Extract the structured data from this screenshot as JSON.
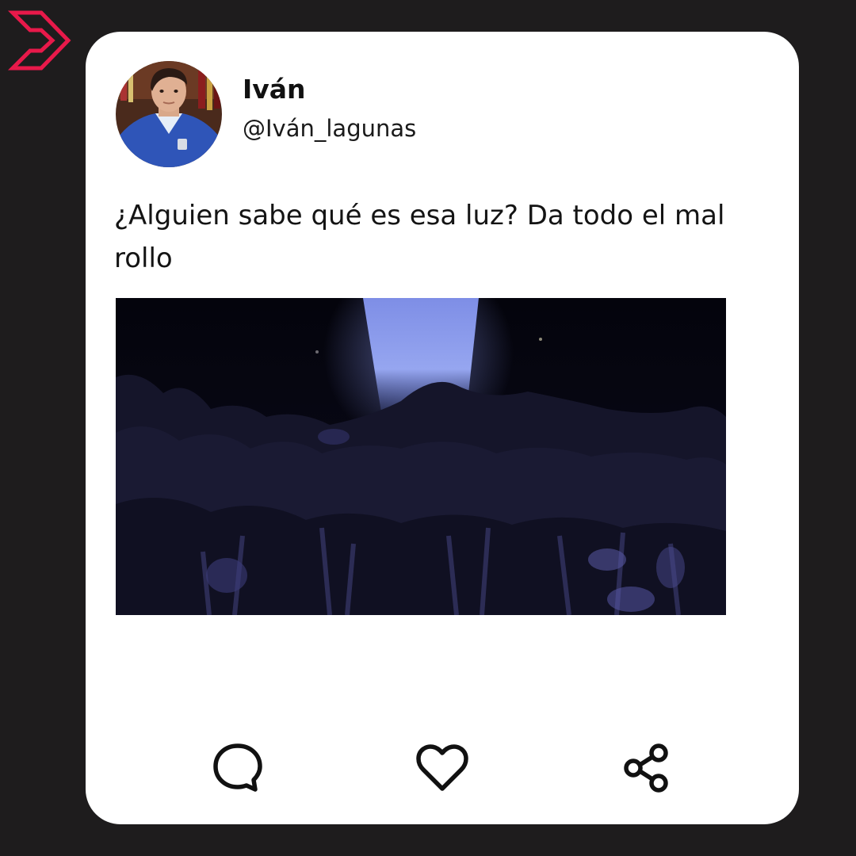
{
  "post": {
    "display_name": "Iván",
    "handle": "@Iván_lagunas",
    "text": "¿Alguien sabe qué es esa luz? Da todo el mal rollo"
  },
  "actions": {
    "reply_icon": "comment-bubble-icon",
    "like_icon": "heart-icon",
    "share_icon": "share-nodes-icon"
  },
  "colors": {
    "background": "#1e1c1d",
    "card": "#ffffff",
    "brand_accent": "#e8194a",
    "text": "#141414"
  }
}
